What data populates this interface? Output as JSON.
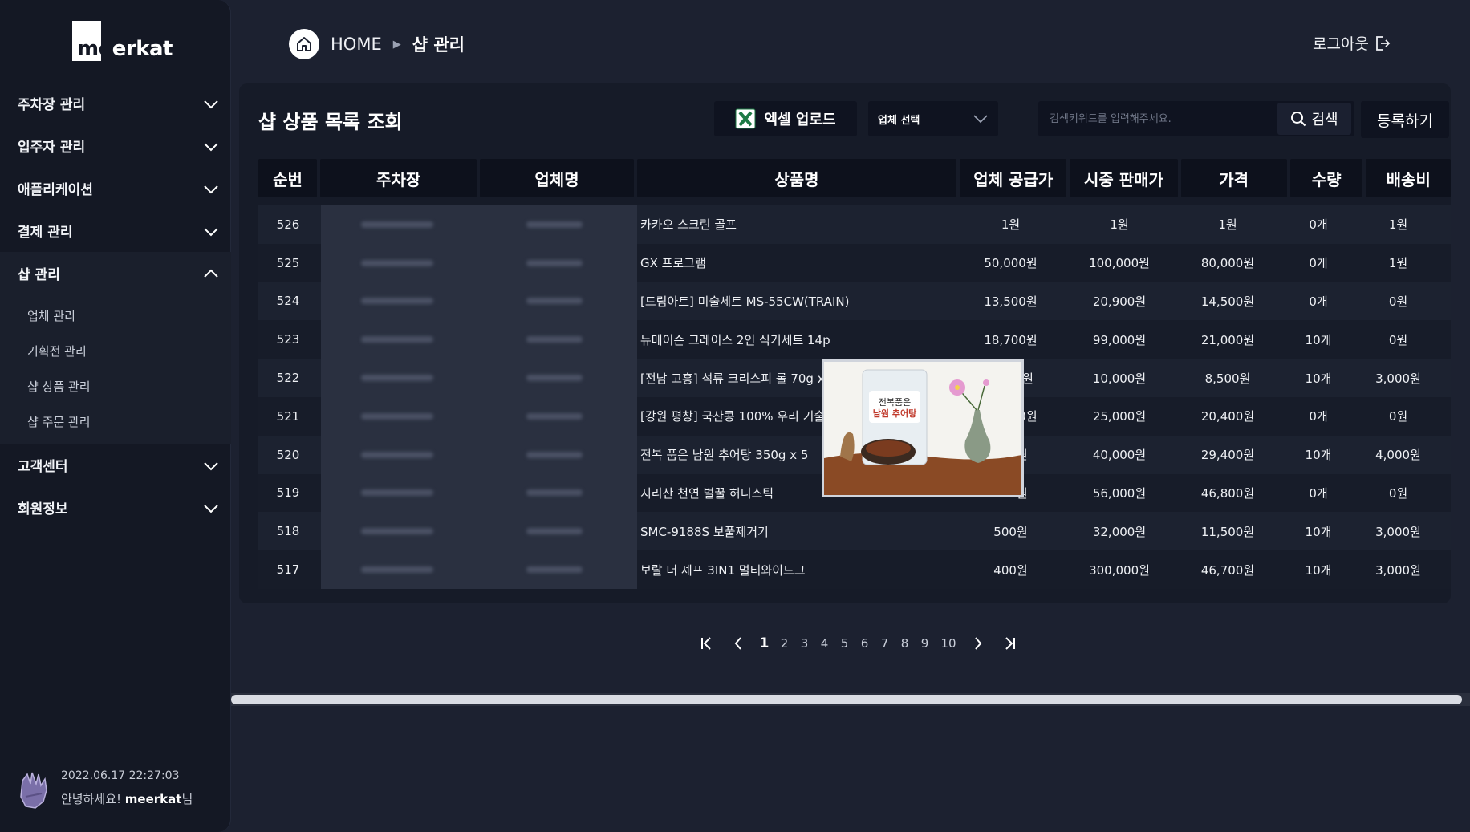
{
  "sidebar": {
    "logo_text": "meerkat",
    "menu": [
      {
        "label": "주차장 관리",
        "icon": "chevron-down-icon"
      },
      {
        "label": "입주자 관리",
        "icon": "chevron-down-icon"
      },
      {
        "label": "애플리케이션",
        "icon": "chevron-down-icon"
      },
      {
        "label": "결제 관리",
        "icon": "chevron-down-icon"
      },
      {
        "label": "샵 관리",
        "icon": "chevron-up-icon"
      }
    ],
    "submenu": [
      "업체 관리",
      "기획전 관리",
      "샵 상품 관리",
      "샵 주문 관리"
    ],
    "menu_after": [
      {
        "label": "고객센터",
        "icon": "chevron-down-icon"
      },
      {
        "label": "회원정보",
        "icon": "chevron-down-icon"
      }
    ],
    "user": {
      "timestamp": "2022.06.17 22:27:03",
      "greeting_prefix": "안녕하세요! ",
      "name": "meerkat",
      "greeting_suffix": "님"
    }
  },
  "header": {
    "home": "HOME",
    "current": "샵 관리",
    "logout": "로그아웃"
  },
  "panel": {
    "title": "샵 상품 목록 조회",
    "excel_button": "엑셀 업로드",
    "vendor_select": "업체 선택",
    "search_placeholder": "검색키워드를 입력해주세요.",
    "search_button": "검색",
    "register_button": "등록하기"
  },
  "table": {
    "columns": [
      "순번",
      "주차장",
      "업체명",
      "상품명",
      "업체 공급가",
      "시중 판매가",
      "가격",
      "수량",
      "배송비"
    ],
    "rows": [
      {
        "no": "526",
        "product": "카카오 스크린 골프",
        "supply": "1원",
        "market": "1원",
        "price": "1원",
        "qty": "0개",
        "ship": "1원"
      },
      {
        "no": "525",
        "product": "GX 프로그램",
        "supply": "50,000원",
        "market": "100,000원",
        "price": "80,000원",
        "qty": "0개",
        "ship": "1원"
      },
      {
        "no": "524",
        "product": "[드림아트] 미술세트 MS-55CW(TRAIN)",
        "supply": "13,500원",
        "market": "20,900원",
        "price": "14,500원",
        "qty": "0개",
        "ship": "0원"
      },
      {
        "no": "523",
        "product": "뉴메이슨 그레이스 2인 식기세트 14p",
        "supply": "18,700원",
        "market": "99,000원",
        "price": "21,000원",
        "qty": "10개",
        "ship": "0원"
      },
      {
        "no": "522",
        "product": "[전남 고흥] 석류 크리스피 롤 70g x 3봉",
        "supply": "7,700원",
        "market": "10,000원",
        "price": "8,500원",
        "qty": "10개",
        "ship": "3,000원"
      },
      {
        "no": "521",
        "product": "[강원 평창] 국산콩 100% 우리 기술로 만든 평창 나또",
        "supply": "19,000원",
        "market": "25,000원",
        "price": "20,400원",
        "qty": "0개",
        "ship": "0원"
      },
      {
        "no": "520",
        "product": "전복 품은 남원 추어탕 350g x 5",
        "supply": "000원",
        "market": "40,000원",
        "price": "29,400원",
        "qty": "10개",
        "ship": "4,000원"
      },
      {
        "no": "519",
        "product": "지리산 천연 벌꿀 허니스틱",
        "supply": "500원",
        "market": "56,000원",
        "price": "46,800원",
        "qty": "0개",
        "ship": "0원"
      },
      {
        "no": "518",
        "product": "SMC-9188S 보풀제거기",
        "supply": "500원",
        "market": "32,000원",
        "price": "11,500원",
        "qty": "10개",
        "ship": "3,000원"
      },
      {
        "no": "517",
        "product": "보랄 더 셰프 3IN1 멀티와이드그",
        "supply": "400원",
        "market": "300,000원",
        "price": "46,700원",
        "qty": "10개",
        "ship": "3,000원"
      }
    ]
  },
  "product_image": {
    "package_line1": "전복품은",
    "package_line2": "남원 추어탕"
  },
  "pagination": {
    "current": "1",
    "pages": [
      "1",
      "2",
      "3",
      "4",
      "5",
      "6",
      "7",
      "8",
      "9",
      "10"
    ]
  },
  "colors": {
    "background": "#1c2130",
    "sidebar": "#141824",
    "header_cell": "#0d111c",
    "excel_green": "#1d7a45"
  }
}
